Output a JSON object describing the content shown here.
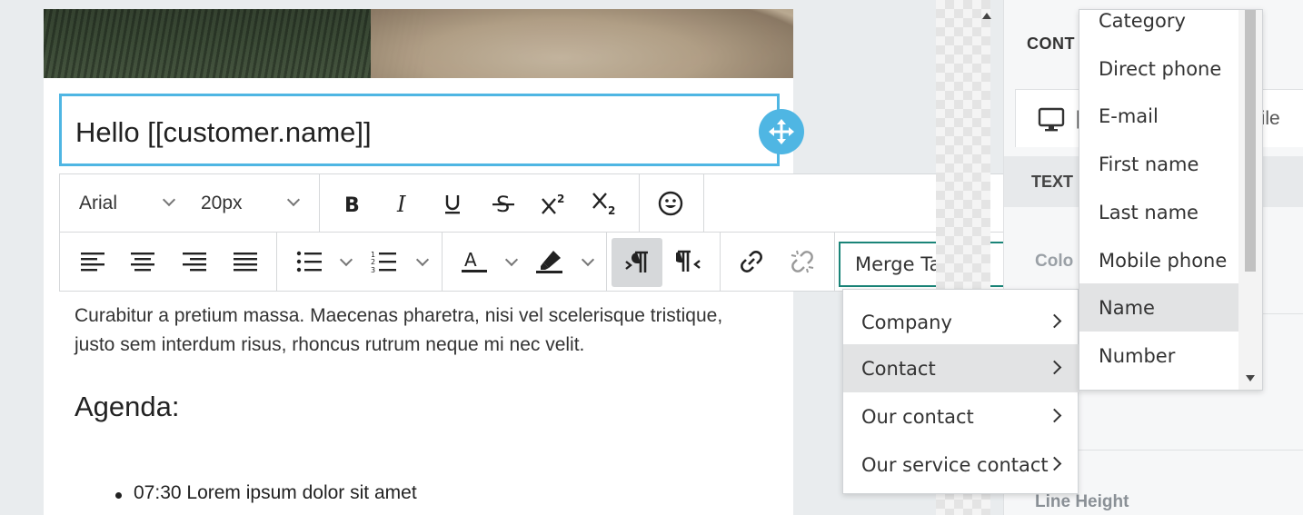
{
  "editor": {
    "title_text": "Hello [[customer.name]]",
    "paragraph": "Curabitur a pretium massa. Maecenas pharetra, nisi vel scelerisque tristique, justo sem interdum risus, rhoncus rutrum neque mi nec velit.",
    "heading": "Agenda:",
    "bullets": [
      "07:30 Lorem ipsum dolor sit amet"
    ]
  },
  "toolbar": {
    "font_family": "Arial",
    "font_size": "20px",
    "merge_tags_label": "Merge Tags"
  },
  "merge_menu": {
    "items": [
      "Company",
      "Contact",
      "Our contact",
      "Our service contact"
    ],
    "selected": "Contact"
  },
  "contact_submenu": {
    "items": [
      "Category",
      "Direct phone",
      "E-mail",
      "First name",
      "Last name",
      "Mobile phone",
      "Name",
      "Number"
    ],
    "selected": "Name"
  },
  "side_panel": {
    "header": "CONT",
    "tab_partial": "bile",
    "tab_partial_left": "[",
    "section": "TEXT",
    "color_label": "Colo",
    "line_height_label": "Line Height"
  },
  "colors": {
    "accent_blue": "#4fb6e3",
    "merge_border": "#1a8478"
  }
}
